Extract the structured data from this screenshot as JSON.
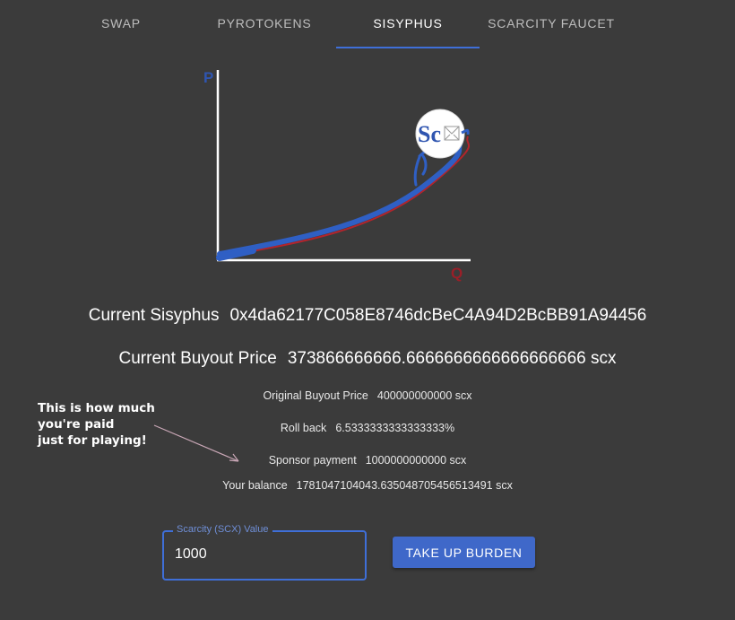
{
  "tabs": [
    {
      "label": "SWAP",
      "active": false
    },
    {
      "label": "PYROTOKENS",
      "active": false
    },
    {
      "label": "SISYPHUS",
      "active": true
    },
    {
      "label": "SCARCITY FAUCET",
      "active": false
    }
  ],
  "graph": {
    "y_axis_label": "P",
    "x_axis_label": "Q",
    "coin_label": "Sc"
  },
  "current_sisyphus": {
    "label": "Current Sisyphus",
    "value": "0x4da62177C058E8746dcBeC4A94D2BcBB91A94456"
  },
  "buyout_price": {
    "label": "Current Buyout Price",
    "value": "373866666666.6666666666666666666 scx"
  },
  "original_buyout_price": {
    "label": "Original Buyout Price",
    "value": "400000000000 scx"
  },
  "roll_back": {
    "label": "Roll back",
    "value": "6.5333333333333333%"
  },
  "sponsor_payment": {
    "label": "Sponsor payment",
    "value": "1000000000000 scx"
  },
  "your_balance": {
    "label": "Your balance",
    "value": "1781047104043.635048705456513491 scx"
  },
  "annotation": {
    "text": "This is how much\nyou're paid\njust for playing!"
  },
  "input": {
    "label": "Scarcity (SCX) Value",
    "value": "1000"
  },
  "take_up_burden_button": {
    "label": "TAKE UP BURDEN"
  },
  "colors": {
    "background": "#3b3b3b",
    "accent": "#3f6fd8",
    "curve_red": "#b3242c"
  }
}
